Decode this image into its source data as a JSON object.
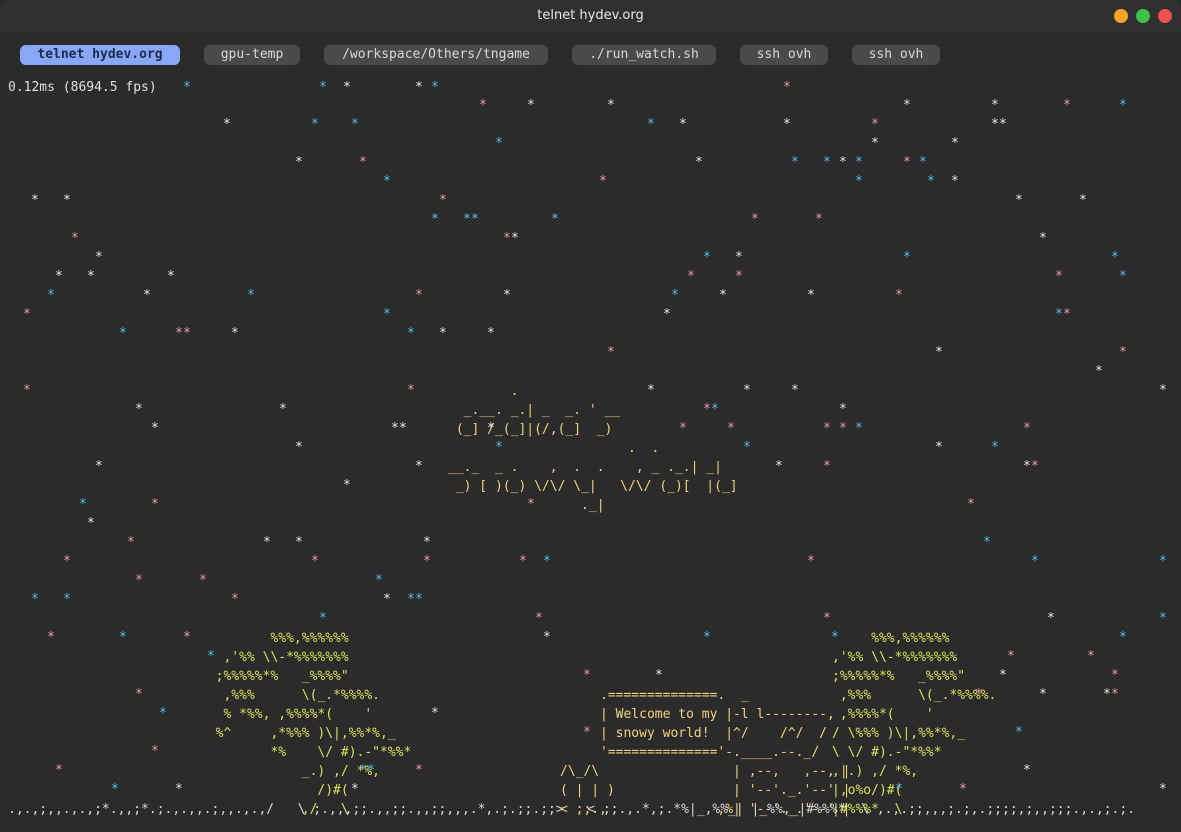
{
  "window": {
    "title": "telnet hydev.org"
  },
  "colors": {
    "star_white": "#e8e8e8",
    "star_pink": "#f09aa8",
    "star_blue": "#56bde8",
    "logo": "#f2d27a",
    "tree": "#d8e25a",
    "sign": "#f2d27a",
    "ground": "#d8d8d8",
    "tab_active": "#88a8f7",
    "tab": "#4a4a4a"
  },
  "tabs": [
    {
      "label": "telnet hydev.org",
      "active": true
    },
    {
      "label": "gpu-temp",
      "active": false
    },
    {
      "label": "/workspace/Others/tngame",
      "active": false
    },
    {
      "label": "./run_watch.sh",
      "active": false
    },
    {
      "label": "ssh ovh",
      "active": false
    },
    {
      "label": "ssh ovh",
      "active": false
    }
  ],
  "terminal": {
    "fps_text": "0.12ms (8694.5 fps)",
    "star_glyph": "*",
    "logo_lines": [
      "        .",
      "  _.__. _.| _  _. ' __",
      " (_] /_(_]|(/,(_]  _)",
      "                       .  .",
      "__._  _ .    ,  .  .    , _ ._.| _|",
      " _) [ )(_) \\/\\/ \\_|   \\/\\/ (_)[  |(_]",
      "                 ._|"
    ],
    "tree_left_lines": [
      "         %%%,%%%%%%",
      "   ,'%% \\\\-*%%%%%%%",
      "  ;%%%%%*%   _%%%%\"",
      "   ,%%%      \\(_.*%%%%.",
      "   % *%%, ,%%%%*(    '",
      "  %^     ,*%%% )\\|,%%*%,_",
      "         *%    \\/ #).-\"*%%*",
      "             _.) ,/ *%,",
      "               /)#(",
      "             ,/   \\"
    ],
    "tree_right_lines": [
      "     %%%,%%%%%%",
      ",'%% \\\\-*%%%%%%%",
      ";%%%%%*%   _%%%%\"",
      " ,%%%      \\(_.*%%%%.",
      " ,%%%%*(    '",
      "/ \\%%% )\\|,%%*%,_",
      "\\ \\/ #).-\"*%%*",
      ",|.) ,/ *%,",
      "|,o%o/)#(",
      "|#%%%*  \\"
    ],
    "sign_lines": [
      ".==============.  _",
      "| Welcome to my |-l l--------,",
      "| snowy world!  |^/    /^/  /",
      "'=============='-.____.--._/",
      "                 | ,--,   ,--, |",
      "                 | '--'._.'--' |",
      "               ,%| '--'._.'--' |"
    ],
    "house_left_lines": [
      "/\\_/\\",
      "( | | )",
      "< ;;.,"
    ],
    "ground_line": ".,.,;,,.,.,;*.,,;*.;.,.,,.;,,.,.,/   \\ ;.,,,;;.,,;;.,,;;,,,.*,.;.;;.;;>   < ;;.,.*,;.*%|_,%%_| |_%%,_|#%%%*  \\ ,.,.;;,,,;.;,.;;;;,;,,;;;.,.,;.;."
  }
}
